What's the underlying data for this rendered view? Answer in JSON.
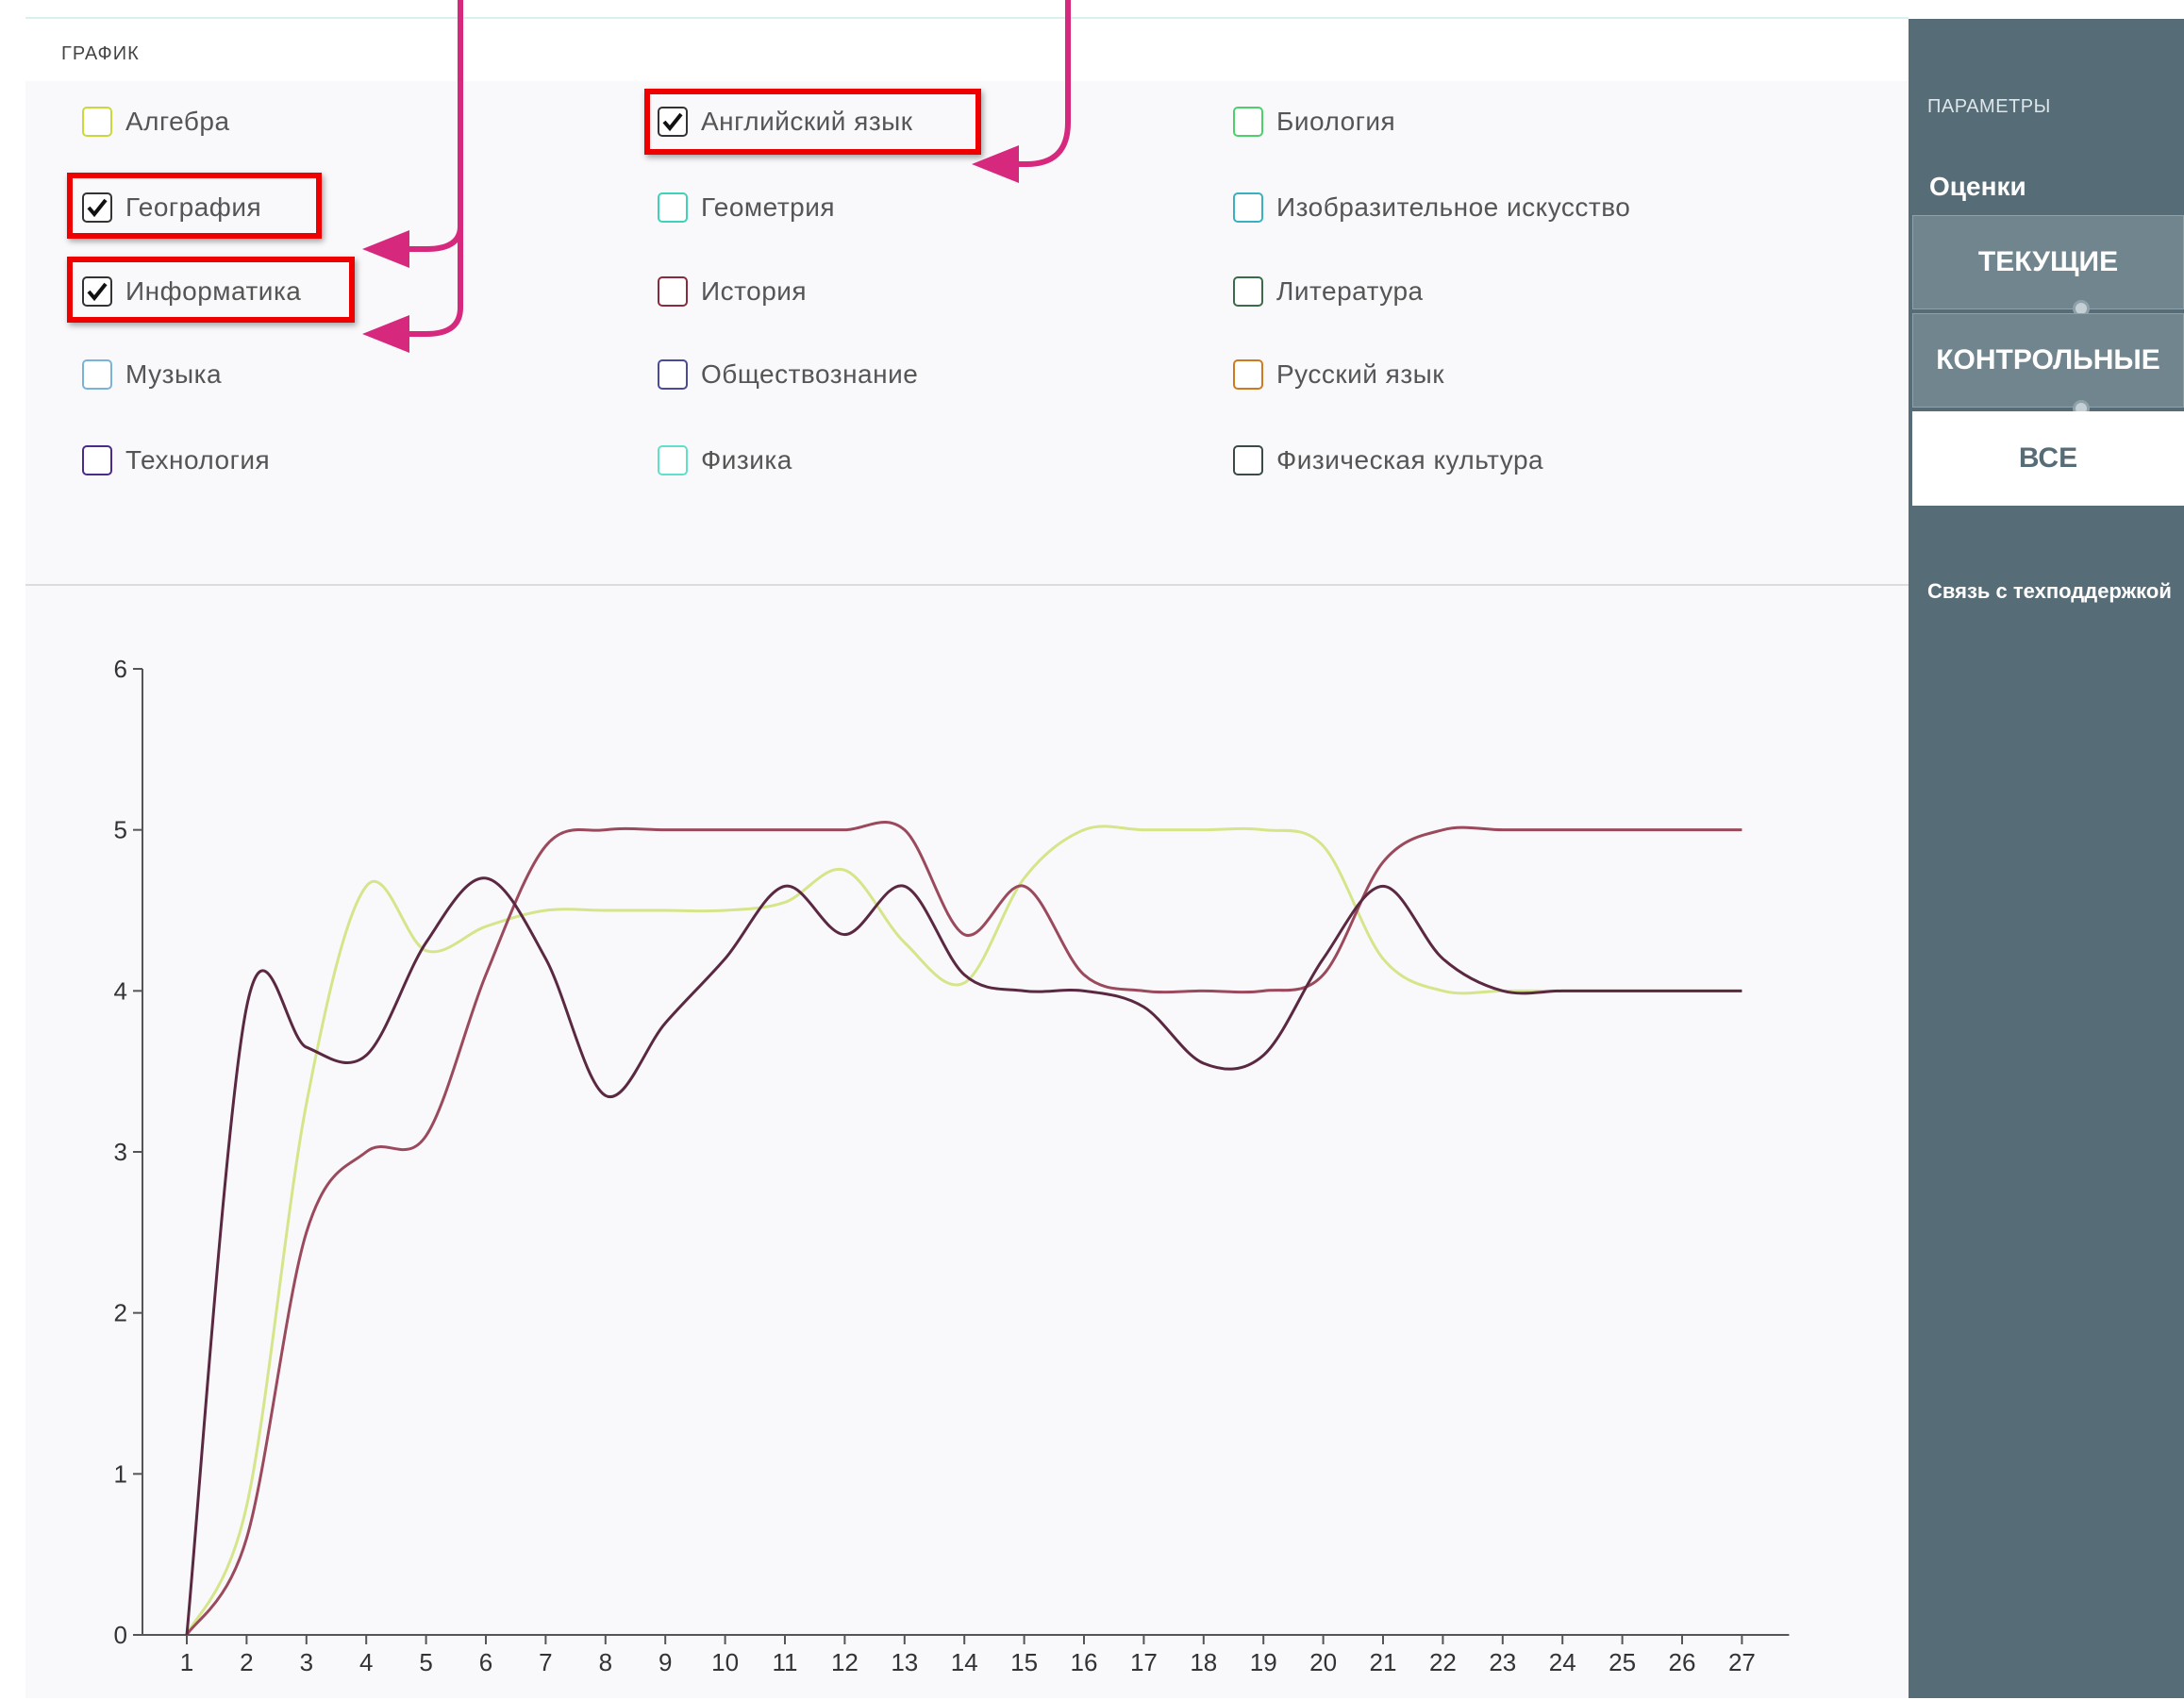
{
  "main": {
    "title": "ГРАФИК"
  },
  "subjects": [
    {
      "label": "Алгебра",
      "checked": false,
      "color": "#c9d93a",
      "col": 0,
      "row": 0
    },
    {
      "label": "Английский язык",
      "checked": true,
      "color": "#333333",
      "col": 1,
      "row": 0
    },
    {
      "label": "Биология",
      "checked": false,
      "color": "#4cd06a",
      "col": 2,
      "row": 0
    },
    {
      "label": "География",
      "checked": true,
      "color": "#333333",
      "col": 0,
      "row": 1
    },
    {
      "label": "Геометрия",
      "checked": false,
      "color": "#3fd2b8",
      "col": 1,
      "row": 1
    },
    {
      "label": "Изобразительное искусство",
      "checked": false,
      "color": "#3bb0c0",
      "col": 2,
      "row": 1
    },
    {
      "label": "Информатика",
      "checked": true,
      "color": "#333333",
      "col": 0,
      "row": 2
    },
    {
      "label": "История",
      "checked": false,
      "color": "#8b2a3e",
      "col": 1,
      "row": 2
    },
    {
      "label": "Литература",
      "checked": false,
      "color": "#3a6b4a",
      "col": 2,
      "row": 2
    },
    {
      "label": "Музыка",
      "checked": false,
      "color": "#7ab3d8",
      "col": 0,
      "row": 3
    },
    {
      "label": "Обществознание",
      "checked": false,
      "color": "#4a4a9a",
      "col": 1,
      "row": 3
    },
    {
      "label": "Русский язык",
      "checked": false,
      "color": "#d07a20",
      "col": 2,
      "row": 3
    },
    {
      "label": "Технология",
      "checked": false,
      "color": "#4a2a8a",
      "col": 0,
      "row": 4
    },
    {
      "label": "Физика",
      "checked": false,
      "color": "#60e0c8",
      "col": 1,
      "row": 4
    },
    {
      "label": "Физическая культура",
      "checked": false,
      "color": "#3a4a4a",
      "col": 2,
      "row": 4
    }
  ],
  "sidebar": {
    "params_label": "ПАРАМЕТРЫ",
    "grades_label": "Оценки",
    "buttons": [
      {
        "label": "ТЕКУЩИЕ",
        "active": false
      },
      {
        "label": "КОНТРОЛЬНЫЕ",
        "active": false
      },
      {
        "label": "ВСЕ",
        "active": true
      }
    ],
    "support_label": "Связь с техподдержкой"
  },
  "colors": {
    "highlight": "#ee0000",
    "arrow": "#d6297e",
    "sidebar": "#566d78"
  },
  "chart_data": {
    "type": "line",
    "x": [
      1,
      2,
      3,
      4,
      5,
      6,
      7,
      8,
      9,
      10,
      11,
      12,
      13,
      14,
      15,
      16,
      17,
      18,
      19,
      20,
      21,
      22,
      23,
      24,
      25,
      26,
      27
    ],
    "ylim": [
      0,
      6
    ],
    "y_ticks": [
      0,
      1,
      2,
      3,
      4,
      5,
      6
    ],
    "x_ticks": [
      1,
      2,
      3,
      4,
      5,
      6,
      7,
      8,
      9,
      10,
      11,
      12,
      13,
      14,
      15,
      16,
      17,
      18,
      19,
      20,
      21,
      22,
      23,
      24,
      25,
      26,
      27
    ],
    "series": [
      {
        "color": "#d5e58a",
        "values": [
          0,
          0.8,
          3.3,
          4.65,
          4.25,
          4.4,
          4.5,
          4.5,
          4.5,
          4.5,
          4.55,
          4.75,
          4.3,
          4.05,
          4.7,
          5,
          5,
          5,
          5,
          4.9,
          4.2,
          4,
          4,
          4,
          4,
          4,
          4
        ]
      },
      {
        "color": "#9a4a5c",
        "values": [
          0,
          0.6,
          2.5,
          3,
          3.1,
          4.1,
          4.9,
          5,
          5,
          5,
          5,
          5,
          5,
          4.35,
          4.65,
          4.1,
          4,
          4,
          4,
          4.1,
          4.8,
          5,
          5,
          5,
          5,
          5,
          5
        ]
      },
      {
        "color": "#5a2840",
        "values": [
          0,
          3.9,
          3.65,
          3.6,
          4.3,
          4.7,
          4.2,
          3.35,
          3.8,
          4.2,
          4.65,
          4.35,
          4.65,
          4.1,
          4,
          4,
          3.9,
          3.55,
          3.6,
          4.2,
          4.65,
          4.2,
          4,
          4,
          4,
          4,
          4
        ]
      }
    ]
  }
}
